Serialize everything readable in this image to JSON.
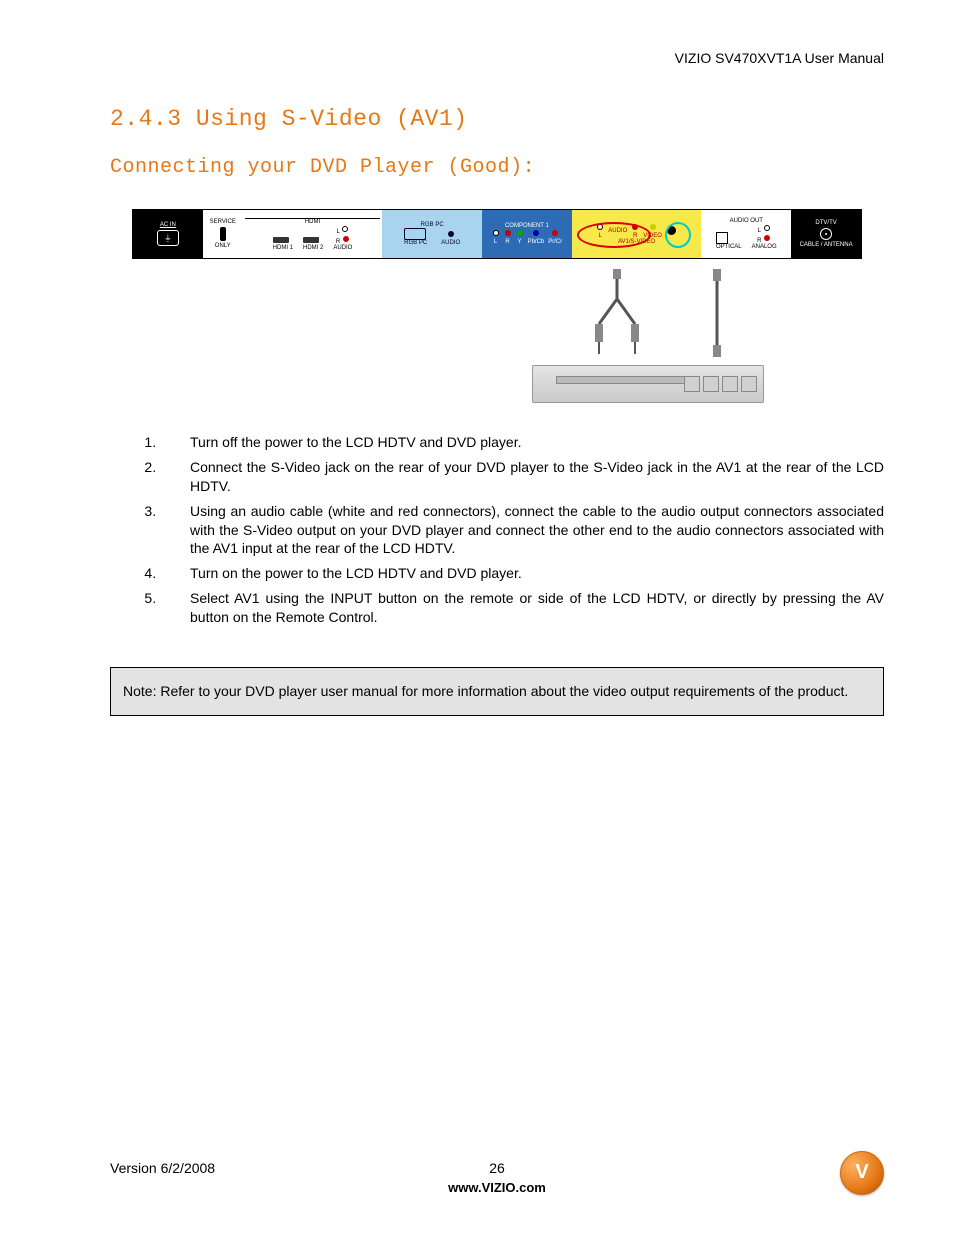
{
  "header": {
    "manual_title": "VIZIO SV470XVT1A User Manual"
  },
  "titles": {
    "section": "2.4.3 Using S-Video (AV1)",
    "subsection": "Connecting your DVD Player (Good):"
  },
  "panel": {
    "ac_in": "AC IN",
    "service": "SERVICE",
    "only": "ONLY",
    "hdmi": "HDMI",
    "hdmi1": "HDMI 1",
    "hdmi2": "HDMI 2",
    "l": "L",
    "r": "R",
    "audio": "AUDIO",
    "rgb_pc": "RGB PC",
    "rgb_pc_port": "RGB PC",
    "component1": "COMPONENT 1",
    "y": "Y",
    "pbcb": "Pb/Cb",
    "prcr": "Pr/Cr",
    "video": "VIDEO",
    "svideo": "S-VIDEO",
    "av1": "AV1",
    "audio_out": "AUDIO OUT",
    "optical": "OPTICAL",
    "analog": "ANALOG",
    "dtv": "DTV/TV",
    "cable": "CABLE / ANTENNA"
  },
  "steps": [
    "Turn off the power to the LCD HDTV and DVD player.",
    "Connect the S-Video jack on the rear of your DVD player to the S-Video jack in the AV1 at the rear of the LCD HDTV.",
    "Using an audio cable (white and red connectors), connect the cable to the audio output connectors associated with the S-Video output on your DVD player and connect the other end to the audio connectors associated with the AV1 input at the rear of the LCD HDTV.",
    "Turn on the power to the LCD HDTV and DVD player.",
    "Select AV1 using the INPUT button on the remote or side of the LCD HDTV, or directly by pressing the AV button on the Remote Control."
  ],
  "note": "Note: Refer to your DVD player user manual for more information about the video output requirements of the product.",
  "footer": {
    "version": "Version 6/2/2008",
    "page": "26",
    "url": "www.VIZIO.com"
  },
  "logo": {
    "letter": "V"
  }
}
